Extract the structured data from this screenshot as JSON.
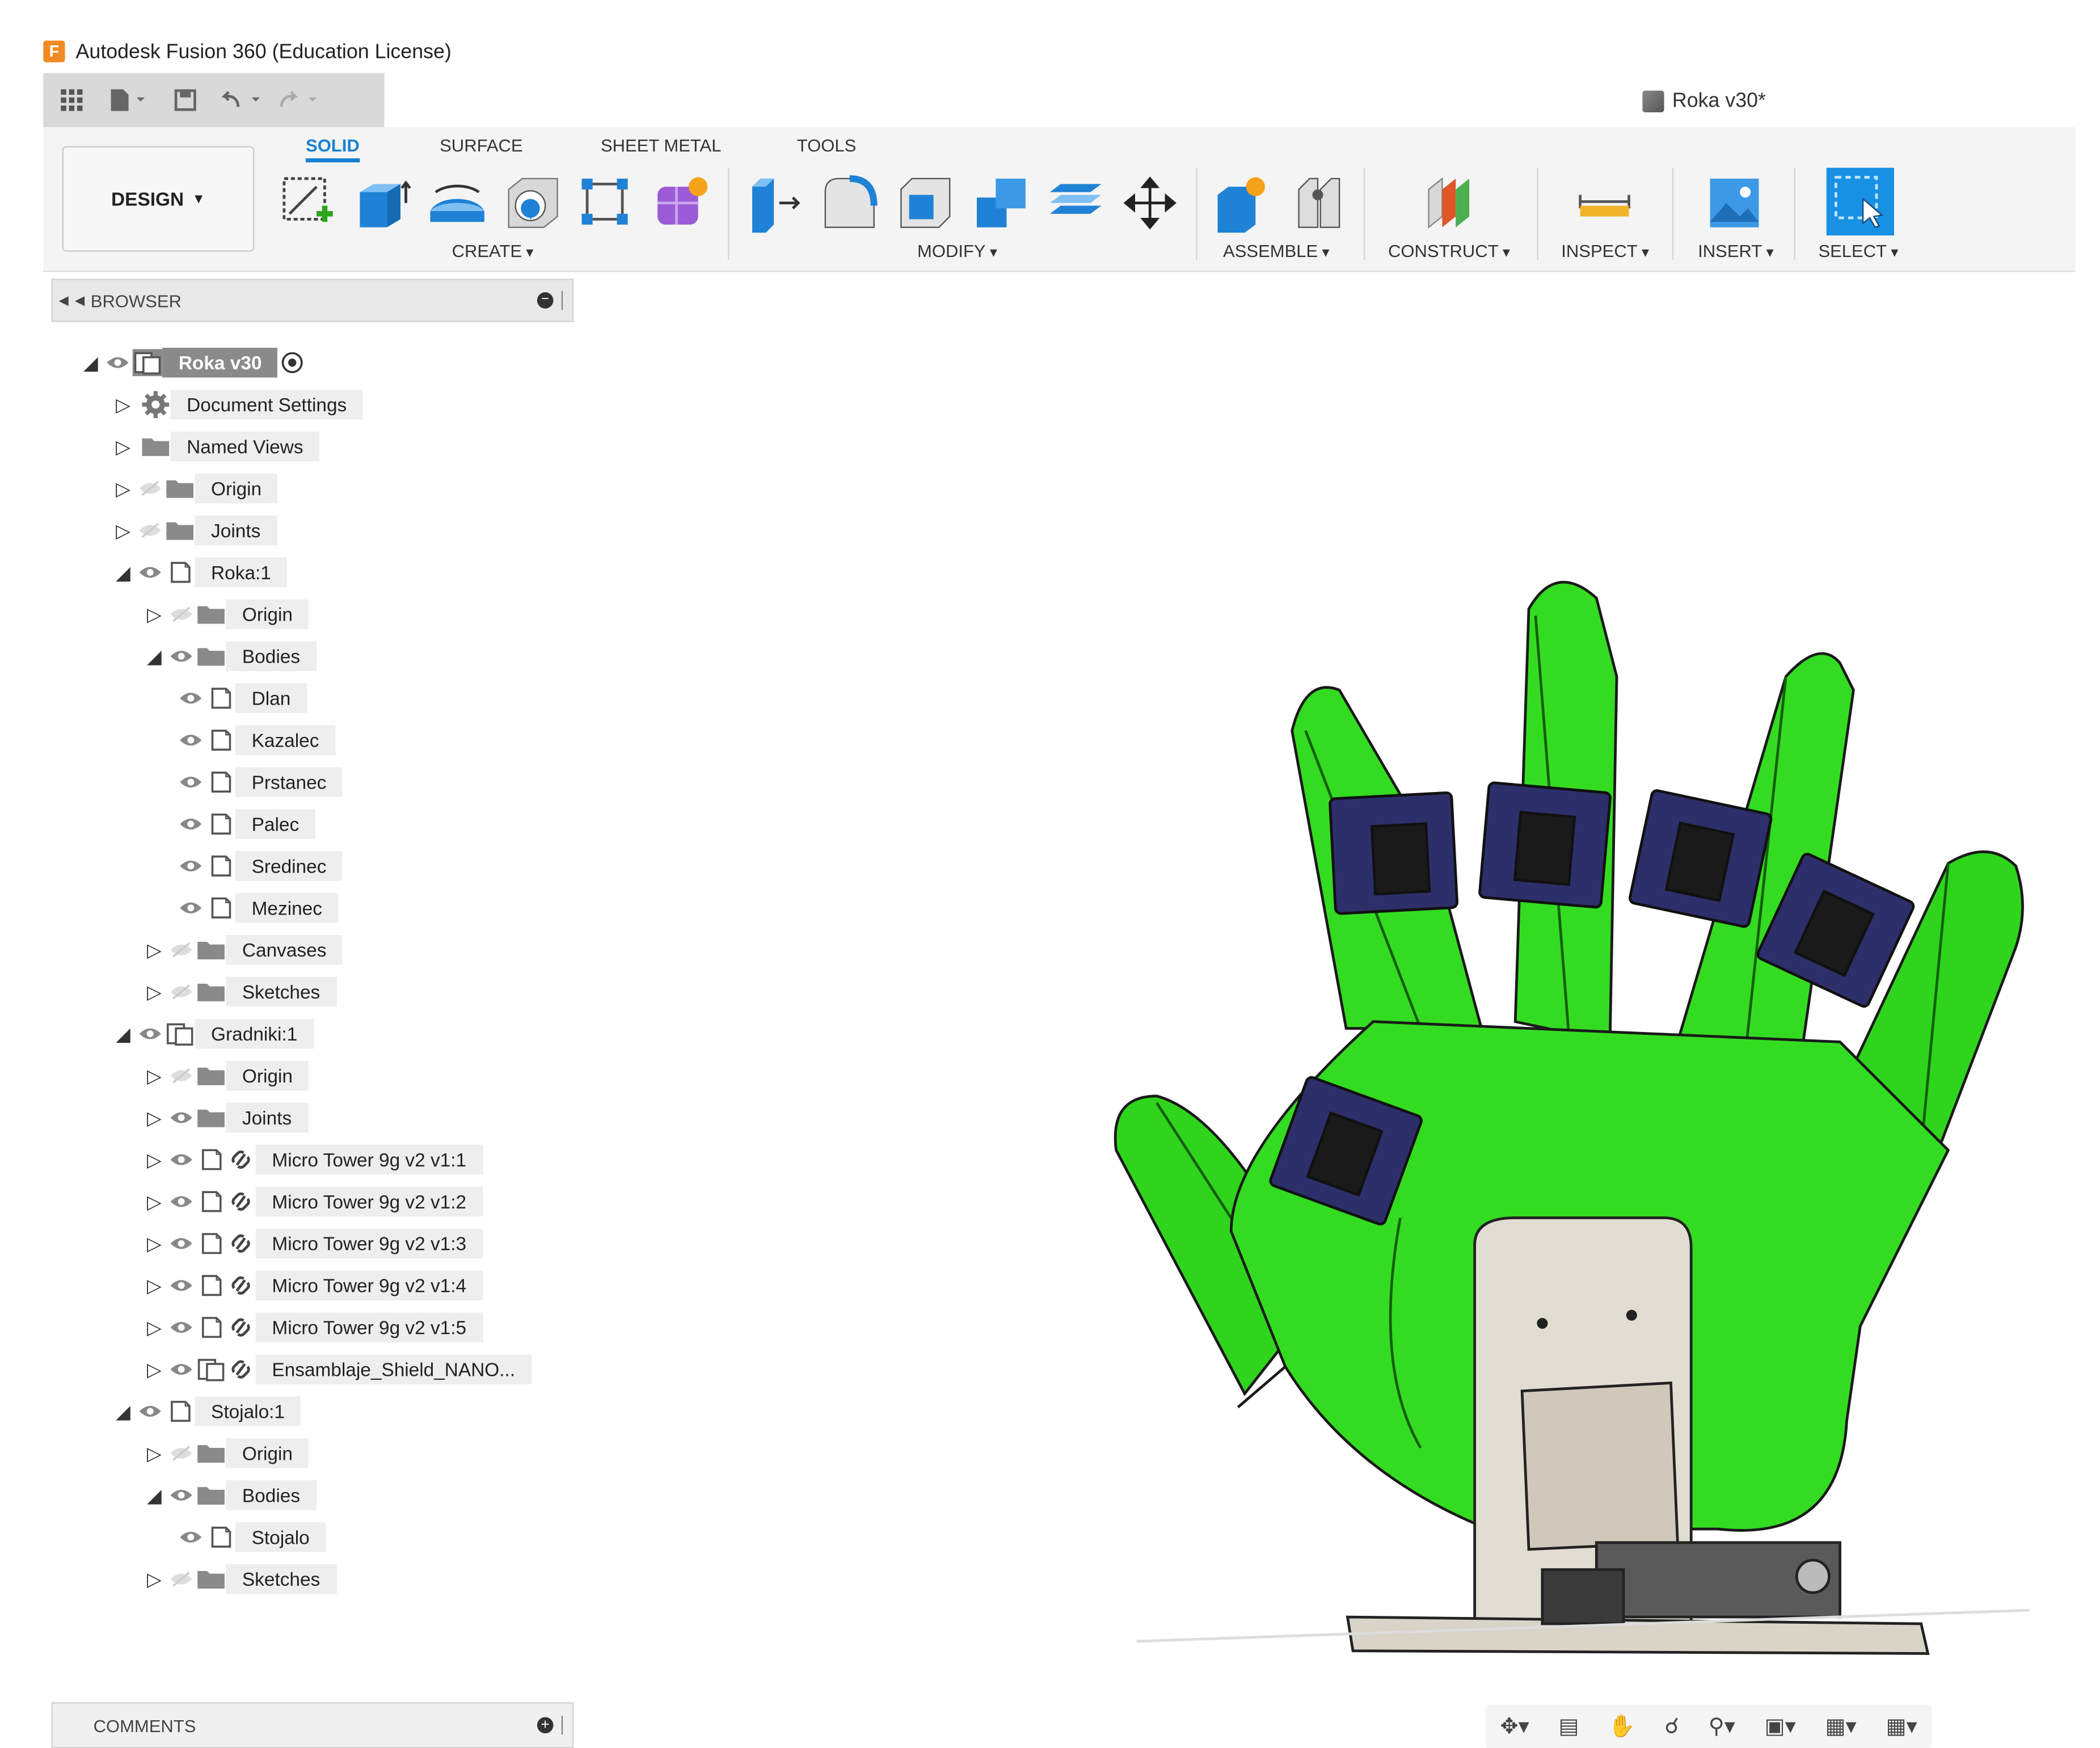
{
  "app": {
    "title": "Autodesk Fusion 360 (Education License)"
  },
  "document": {
    "title": "Roka v30*"
  },
  "workspace": {
    "label": "DESIGN"
  },
  "ribbon": {
    "tabs": [
      "SOLID",
      "SURFACE",
      "SHEET METAL",
      "TOOLS"
    ],
    "active_tab": "SOLID",
    "groups": [
      "CREATE",
      "MODIFY",
      "ASSEMBLE",
      "CONSTRUCT",
      "INSPECT",
      "INSERT",
      "SELECT"
    ]
  },
  "browser": {
    "title": "BROWSER",
    "items": [
      {
        "label": "Roka v30"
      },
      {
        "label": "Document Settings"
      },
      {
        "label": "Named Views"
      },
      {
        "label": "Origin"
      },
      {
        "label": "Joints"
      },
      {
        "label": "Roka:1"
      },
      {
        "label": "Origin"
      },
      {
        "label": "Bodies"
      },
      {
        "label": "Dlan"
      },
      {
        "label": "Kazalec"
      },
      {
        "label": "Prstanec"
      },
      {
        "label": "Palec"
      },
      {
        "label": "Sredinec"
      },
      {
        "label": "Mezinec"
      },
      {
        "label": "Canvases"
      },
      {
        "label": "Sketches"
      },
      {
        "label": "Gradniki:1"
      },
      {
        "label": "Origin"
      },
      {
        "label": "Joints"
      },
      {
        "label": "Micro Tower 9g v2 v1:1"
      },
      {
        "label": "Micro Tower 9g v2 v1:2"
      },
      {
        "label": "Micro Tower 9g v2 v1:3"
      },
      {
        "label": "Micro Tower 9g v2 v1:4"
      },
      {
        "label": "Micro Tower 9g v2 v1:5"
      },
      {
        "label": "Ensamblaje_Shield_NANO..."
      },
      {
        "label": "Stojalo:1"
      },
      {
        "label": "Origin"
      },
      {
        "label": "Bodies"
      },
      {
        "label": "Stojalo"
      },
      {
        "label": "Sketches"
      }
    ]
  },
  "comments": {
    "title": "COMMENTS"
  },
  "colors": {
    "accent": "#1680d1",
    "hand_green": "#33dd1f",
    "servo_blue": "#2d2f6a"
  }
}
